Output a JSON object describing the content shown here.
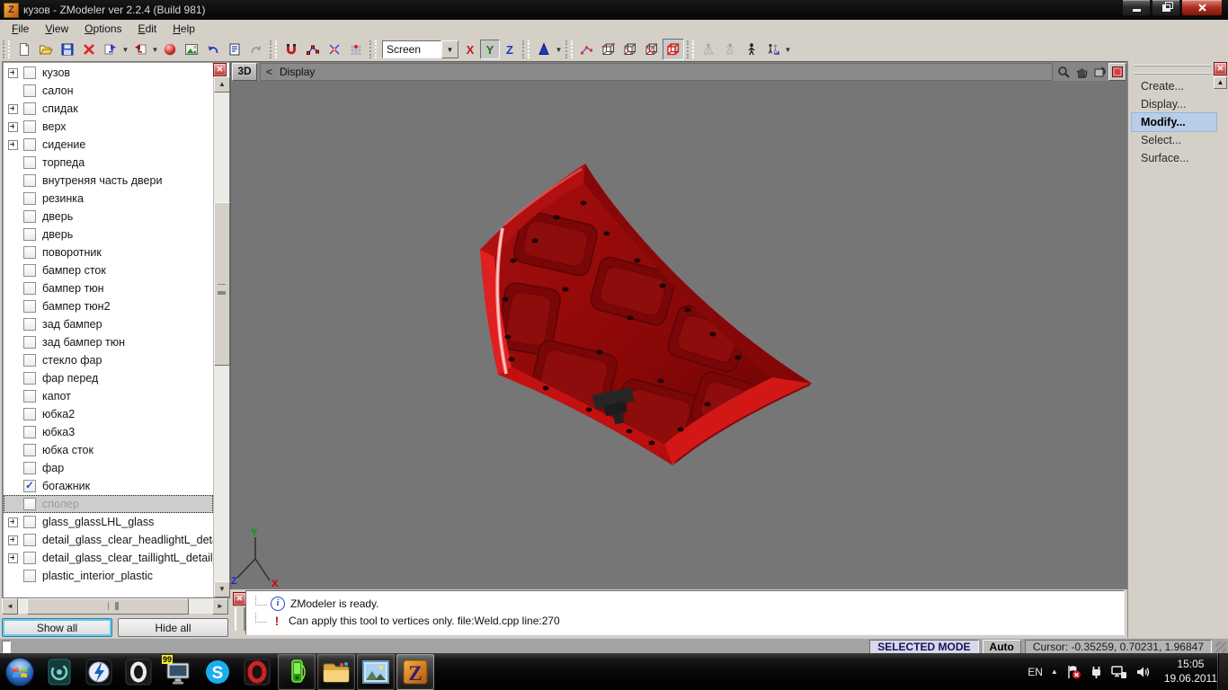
{
  "window": {
    "title": "кузов - ZModeler ver 2.2.4 (Build 981)",
    "icon_letter": "Z",
    "menu": [
      "File",
      "View",
      "Options",
      "Edit",
      "Help"
    ]
  },
  "toolbar": {
    "screen_dropdown": "Screen",
    "axis": [
      "X",
      "Y",
      "Z"
    ]
  },
  "sidebar": {
    "items": [
      {
        "label": "кузов",
        "expander": true
      },
      {
        "label": "салон"
      },
      {
        "label": "спидак",
        "expander": true
      },
      {
        "label": "верх",
        "expander": true
      },
      {
        "label": "сидение",
        "expander": true
      },
      {
        "label": "торпеда"
      },
      {
        "label": "внутреняя часть двери"
      },
      {
        "label": "резинка"
      },
      {
        "label": "дверь"
      },
      {
        "label": "дверь"
      },
      {
        "label": "поворотник"
      },
      {
        "label": "бампер сток"
      },
      {
        "label": "бампер тюн"
      },
      {
        "label": "бампер тюн2"
      },
      {
        "label": "зад бампер"
      },
      {
        "label": "зад бампер тюн"
      },
      {
        "label": "стекло фар"
      },
      {
        "label": "фар перед"
      },
      {
        "label": "капот"
      },
      {
        "label": "юбка2"
      },
      {
        "label": "юбка3"
      },
      {
        "label": "юбка сток"
      },
      {
        "label": "фар"
      },
      {
        "label": "богажник",
        "checked": true
      },
      {
        "label": "сполер",
        "selected": true
      },
      {
        "label": "glass_glassLHL_glass",
        "expander": true
      },
      {
        "label": "detail_glass_clear_headlightL_detail_g",
        "expander": true
      },
      {
        "label": "detail_glass_clear_taillightL_detail_gla",
        "expander": true
      },
      {
        "label": "plastic_interior_plastic"
      }
    ],
    "show_all": "Show all",
    "hide_all": "Hide all"
  },
  "viewport": {
    "mode_label": "3D",
    "back_arrow": "<",
    "view_label": "Display"
  },
  "right_panel": {
    "items": [
      "Create...",
      "Display...",
      "Modify...",
      "Select...",
      "Surface..."
    ],
    "active_index": 2
  },
  "log": {
    "messages": [
      {
        "level": "info",
        "text": "ZModeler is ready."
      },
      {
        "level": "warn",
        "text": "Can apply this tool to vertices only. file:Weld.cpp line:270"
      }
    ]
  },
  "statusbar": {
    "selected_mode": "SELECTED MODE",
    "auto": "Auto",
    "cursor": "Cursor: -0.35259, 0.70231, 1.96847"
  },
  "taskbar": {
    "badge": "99",
    "skype_letter": "S",
    "zmodeler_letter": "Z",
    "tray": {
      "lang": "EN",
      "time": "15:05",
      "date": "19.06.2011"
    }
  }
}
